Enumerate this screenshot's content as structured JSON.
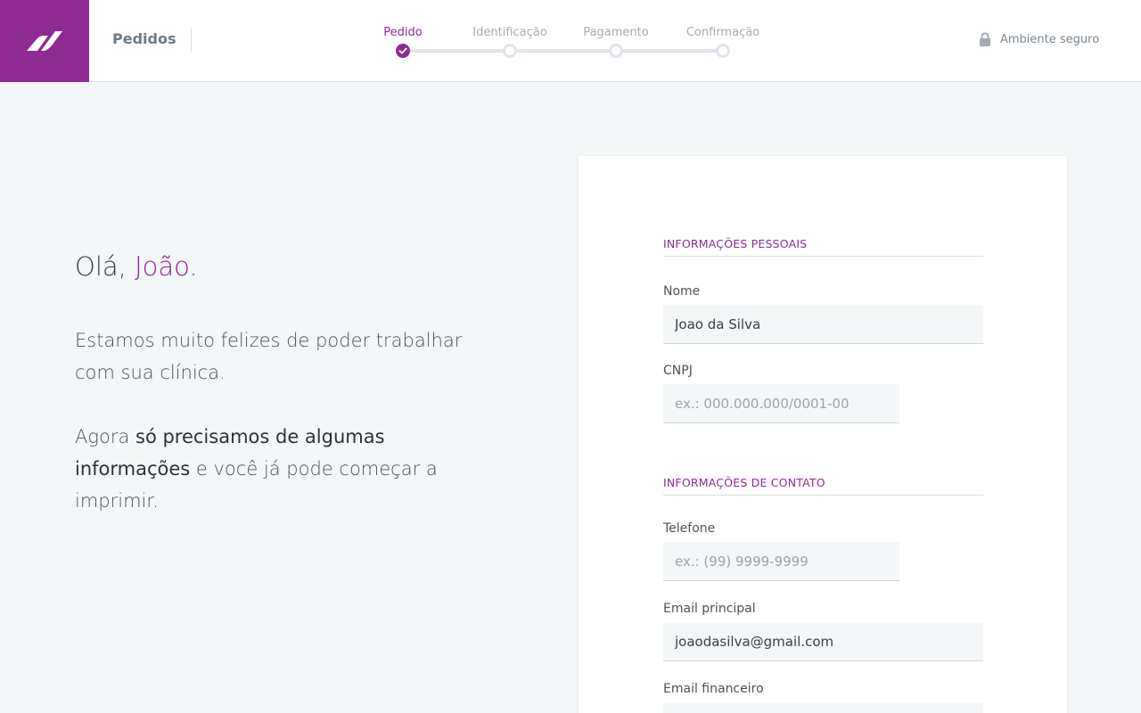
{
  "header": {
    "app_title": "Pedidos",
    "secure_label": "Ambiente seguro",
    "steps": [
      {
        "label": "Pedido",
        "state": "done"
      },
      {
        "label": "Identificação",
        "state": "pending"
      },
      {
        "label": "Pagamento",
        "state": "pending"
      },
      {
        "label": "Confirmação",
        "state": "pending"
      }
    ]
  },
  "intro": {
    "greeting_prefix": "Olá, ",
    "greeting_name": "João.",
    "line1": "Estamos muito felizes de poder trabalhar com sua clínica.",
    "p2_a": "Agora ",
    "p2_b": "só precisamos de algumas informações",
    "p2_c": " e você já pode começar a imprimir."
  },
  "form": {
    "personal_title": "INFORMAÇÕES PESSOAIS",
    "nome_label": "Nome",
    "nome_value": "Joao da Silva",
    "cnpj_label": "CNPJ",
    "cnpj_placeholder": "ex.: 000.000.000/0001-00",
    "contact_title": "INFORMAÇÕES DE CONTATO",
    "telefone_label": "Telefone",
    "telefone_placeholder": "ex.: (99) 9999-9999",
    "email_label": "Email principal",
    "email_value": "joaodasilva@gmail.com",
    "email_fin_label": "Email financeiro"
  },
  "colors": {
    "brand": "#8e2b93",
    "background": "#f4f7f8"
  },
  "icons": [
    "brand-logo-icon",
    "check-icon",
    "lock-icon"
  ]
}
